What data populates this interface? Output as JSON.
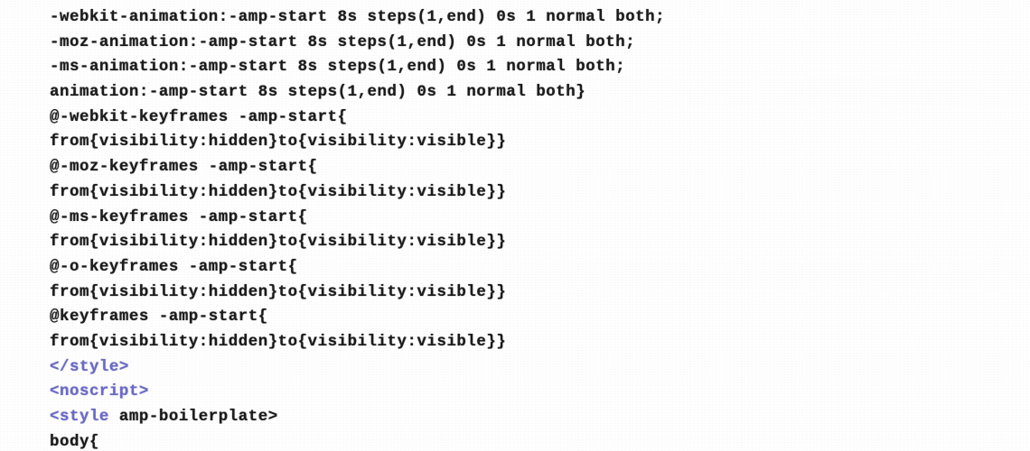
{
  "document": {
    "kind": "code-listing",
    "language": "html-css",
    "description": "AMP boilerplate stylesheet source code listing",
    "background_color": "#ffffff",
    "plain_text_color": "#1a1a1a",
    "tag_text_color": "#6a6ac4"
  },
  "code": {
    "lines": [
      {
        "index": 1,
        "text": "-webkit-animation:-amp-start 8s steps(1,end) 0s 1 normal both;",
        "tokens": [
          {
            "type": "plain",
            "text": "-webkit-animation:-amp-start 8s steps(1,end) 0s 1 normal both;"
          }
        ]
      },
      {
        "index": 2,
        "text": "-moz-animation:-amp-start 8s steps(1,end) 0s 1 normal both;",
        "tokens": [
          {
            "type": "plain",
            "text": "-moz-animation:-amp-start 8s steps(1,end) 0s 1 normal both;"
          }
        ]
      },
      {
        "index": 3,
        "text": "-ms-animation:-amp-start 8s steps(1,end) 0s 1 normal both;",
        "tokens": [
          {
            "type": "plain",
            "text": "-ms-animation:-amp-start 8s steps(1,end) 0s 1 normal both;"
          }
        ]
      },
      {
        "index": 4,
        "text": "animation:-amp-start 8s steps(1,end) 0s 1 normal both}",
        "tokens": [
          {
            "type": "plain",
            "text": "animation:-amp-start 8s steps(1,end) 0s 1 normal both}"
          }
        ]
      },
      {
        "index": 5,
        "text": "@-webkit-keyframes -amp-start{",
        "tokens": [
          {
            "type": "plain",
            "text": "@-webkit-keyframes -amp-start{"
          }
        ]
      },
      {
        "index": 6,
        "text": "from{visibility:hidden}to{visibility:visible}}",
        "tokens": [
          {
            "type": "plain",
            "text": "from{visibility:hidden}to{visibility:visible}}"
          }
        ]
      },
      {
        "index": 7,
        "text": "@-moz-keyframes -amp-start{",
        "tokens": [
          {
            "type": "plain",
            "text": "@-moz-keyframes -amp-start{"
          }
        ]
      },
      {
        "index": 8,
        "text": "from{visibility:hidden}to{visibility:visible}}",
        "tokens": [
          {
            "type": "plain",
            "text": "from{visibility:hidden}to{visibility:visible}}"
          }
        ]
      },
      {
        "index": 9,
        "text": "@-ms-keyframes -amp-start{",
        "tokens": [
          {
            "type": "plain",
            "text": "@-ms-keyframes -amp-start{"
          }
        ]
      },
      {
        "index": 10,
        "text": "from{visibility:hidden}to{visibility:visible}}",
        "tokens": [
          {
            "type": "plain",
            "text": "from{visibility:hidden}to{visibility:visible}}"
          }
        ]
      },
      {
        "index": 11,
        "text": "@-o-keyframes -amp-start{",
        "tokens": [
          {
            "type": "plain",
            "text": "@-o-keyframes -amp-start{"
          }
        ]
      },
      {
        "index": 12,
        "text": "from{visibility:hidden}to{visibility:visible}}",
        "tokens": [
          {
            "type": "plain",
            "text": "from{visibility:hidden}to{visibility:visible}}"
          }
        ]
      },
      {
        "index": 13,
        "text": "@keyframes -amp-start{",
        "tokens": [
          {
            "type": "plain",
            "text": "@keyframes -amp-start{"
          }
        ]
      },
      {
        "index": 14,
        "text": "from{visibility:hidden}to{visibility:visible}}",
        "tokens": [
          {
            "type": "plain",
            "text": "from{visibility:hidden}to{visibility:visible}}"
          }
        ]
      },
      {
        "index": 15,
        "text": "</style>",
        "tokens": [
          {
            "type": "tag",
            "text": "</style>"
          }
        ]
      },
      {
        "index": 16,
        "text": "<noscript>",
        "tokens": [
          {
            "type": "tag",
            "text": "<noscript>"
          }
        ]
      },
      {
        "index": 17,
        "text": "<style amp-boilerplate>",
        "tokens": [
          {
            "type": "tag",
            "text": "<style"
          },
          {
            "type": "plain",
            "text": " amp-boilerplate>"
          }
        ]
      },
      {
        "index": 18,
        "text": "body{",
        "tokens": [
          {
            "type": "plain",
            "text": "body{"
          }
        ]
      }
    ]
  }
}
